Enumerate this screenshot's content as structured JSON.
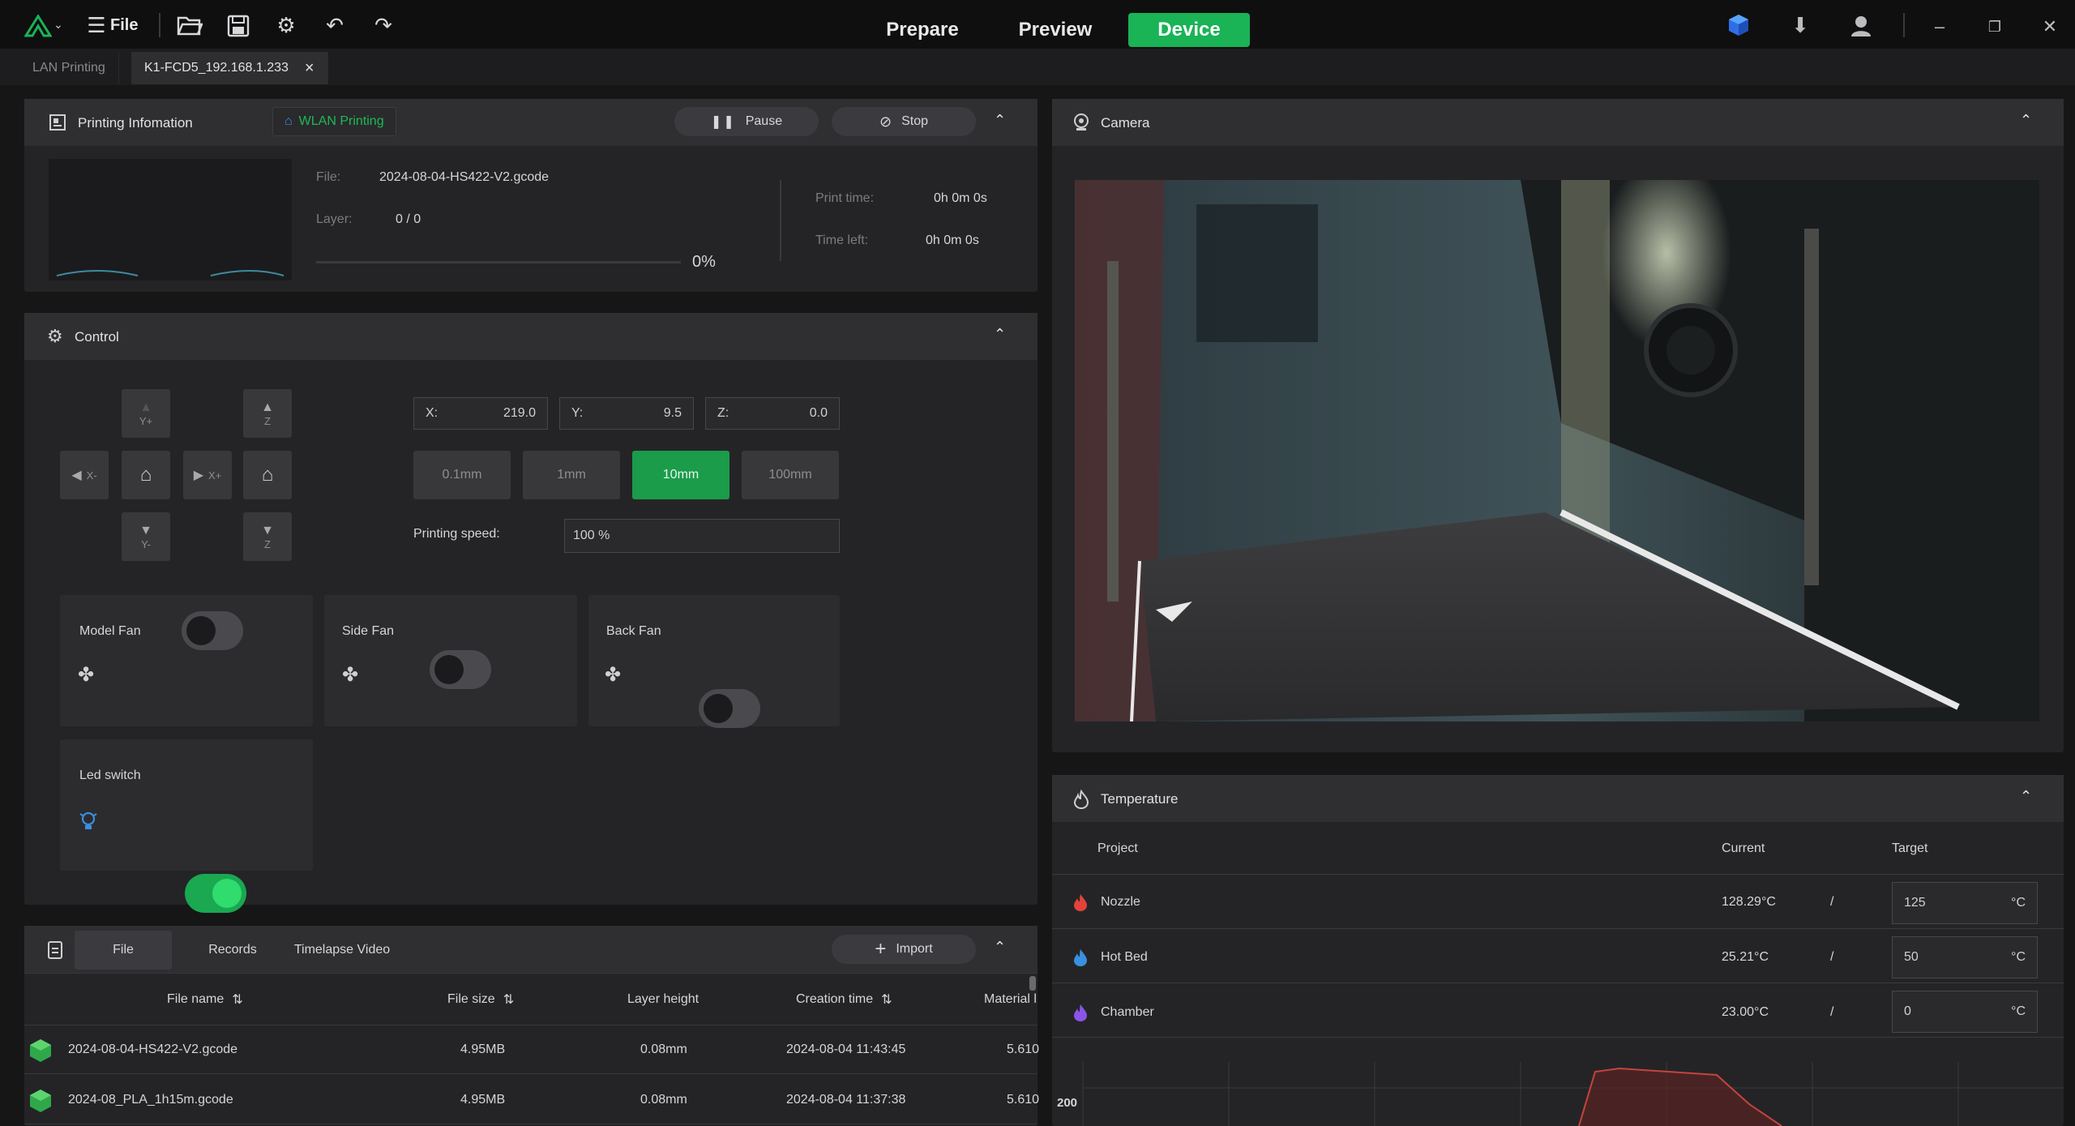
{
  "topbar": {
    "file_label": "File",
    "modes": [
      "Prepare",
      "Preview",
      "Device"
    ],
    "active_mode": "Device"
  },
  "tabs": [
    {
      "label": "LAN Printing"
    },
    {
      "label": "K1-FCD5_192.168.1.233"
    }
  ],
  "printing_info": {
    "title": "Printing Infomation",
    "wlan_tag": "WLAN Printing",
    "pause_label": "Pause",
    "stop_label": "Stop",
    "file_label": "File:",
    "file_value": "2024-08-04-HS422-V2.gcode",
    "layer_label": "Layer:",
    "layer_value": "0 / 0",
    "progress_text": "0%",
    "progress_fraction": 0,
    "print_time_label": "Print time:",
    "print_time_value": "0h 0m 0s",
    "time_left_label": "Time left:",
    "time_left_value": "0h 0m 0s"
  },
  "control": {
    "title": "Control",
    "jog": {
      "y_plus": "Y+",
      "y_minus": "Y-",
      "x_minus": "X-",
      "x_plus": "X+",
      "z_up": "Z",
      "z_down": "Z"
    },
    "x_label": "X:",
    "x_value": "219.0",
    "y_label": "Y:",
    "y_value": "9.5",
    "z_label": "Z:",
    "z_value": "0.0",
    "steps": [
      "0.1mm",
      "1mm",
      "10mm",
      "100mm"
    ],
    "active_step": "10mm",
    "speed_label": "Printing speed:",
    "speed_value": "100 %",
    "fans": [
      {
        "label": "Model Fan",
        "on": false
      },
      {
        "label": "Side Fan",
        "on": false
      },
      {
        "label": "Back Fan",
        "on": false
      }
    ],
    "led": {
      "label": "Led switch",
      "on": true
    }
  },
  "files": {
    "tabs": [
      "File",
      "Records",
      "Timelapse Video"
    ],
    "import_label": "Import",
    "columns": [
      "File name",
      "File size",
      "Layer height",
      "Creation time",
      "Material l"
    ],
    "rows": [
      {
        "name": "2024-08-04-HS422-V2.gcode",
        "size": "4.95MB",
        "layer": "0.08mm",
        "created": "2024-08-04 11:43:45",
        "material": "5.610"
      },
      {
        "name": "2024-08_PLA_1h15m.gcode",
        "size": "4.95MB",
        "layer": "0.08mm",
        "created": "2024-08-04 11:37:38",
        "material": "5.610"
      }
    ]
  },
  "camera": {
    "title": "Camera"
  },
  "temperature": {
    "title": "Temperature",
    "col_project": "Project",
    "col_current": "Current",
    "col_target": "Target",
    "slash": "/",
    "unit": "°C",
    "rows": [
      {
        "name": "Nozzle",
        "current": "128.29°C",
        "target": "125",
        "color": "#e2423a"
      },
      {
        "name": "Hot Bed",
        "current": "25.21°C",
        "target": "50",
        "color": "#3a8fe0"
      },
      {
        "name": "Chamber",
        "current": "23.00°C",
        "target": "0",
        "color": "#8a55e6"
      }
    ],
    "chart_y_tick": "200"
  },
  "colors": {
    "accent": "#1ab356",
    "bg": "#161617",
    "panel": "#242427"
  }
}
